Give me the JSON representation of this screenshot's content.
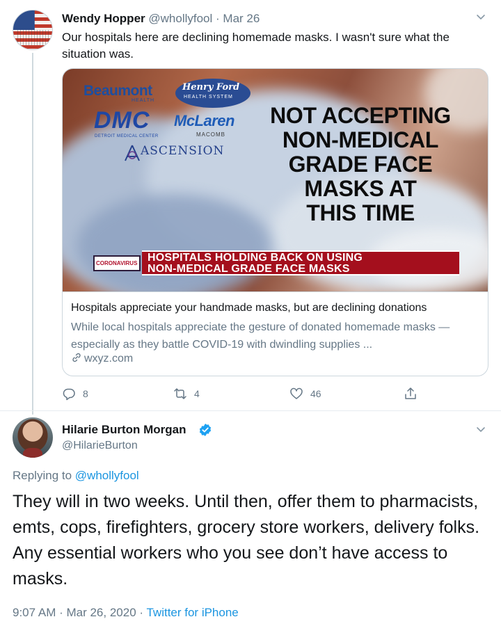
{
  "tweet1": {
    "display_name": "Wendy Hopper",
    "handle": "@whollyfool",
    "separator": "·",
    "date": "Mar 26",
    "text": "Our hospitals here are declining homemade masks.  I wasn't sure what the situation was.",
    "card": {
      "image": {
        "logos": {
          "beaumont": "Beaumont",
          "beaumont_sub": "HEALTH",
          "henry_ford": "Henry Ford",
          "henry_ford_sub": "HEALTH SYSTEM",
          "dmc": "DMC",
          "dmc_sub": "DETROIT MEDICAL CENTER",
          "mclaren": "McLaren",
          "mclaren_sub": "MACOMB",
          "ascension": "ASCENSION"
        },
        "headline_lines": [
          "NOT ACCEPTING",
          "NON-MEDICAL",
          "GRADE FACE",
          "MASKS AT",
          "THIS TIME"
        ],
        "lower_third_tag": "CORONAVIRUS",
        "lower_third_line1": "HOSPITALS HOLDING BACK ON USING",
        "lower_third_line2": "NON-MEDICAL GRADE FACE MASKS"
      },
      "title": "Hospitals appreciate your handmade masks, but are declining donations",
      "description": "While local hospitals appreciate the gesture of donated homemade masks — especially as they battle COVID-19 with dwindling supplies ...",
      "domain": "wxyz.com"
    },
    "actions": {
      "reply_count": "8",
      "retweet_count": "4",
      "like_count": "46"
    }
  },
  "tweet2": {
    "display_name": "Hilarie Burton Morgan",
    "handle": "@HilarieBurton",
    "replying_prefix": "Replying to ",
    "replying_mention": "@whollyfool",
    "text": "They will in two weeks. Until then, offer them to pharmacists, emts, cops, firefighters, grocery store workers, delivery folks. Any essential workers who you see don’t have access to masks.",
    "timestamp": "9:07 AM · Mar 26, 2020 · ",
    "source": "Twitter for iPhone"
  },
  "colors": {
    "secondary_text": "#657786",
    "link": "#1b95e0",
    "verified": "#1da1f2",
    "lower_third_red": "#a40f1d"
  },
  "icons": [
    "caret-down-icon",
    "link-icon",
    "reply-icon",
    "retweet-icon",
    "like-icon",
    "share-icon",
    "verified-badge-icon"
  ]
}
